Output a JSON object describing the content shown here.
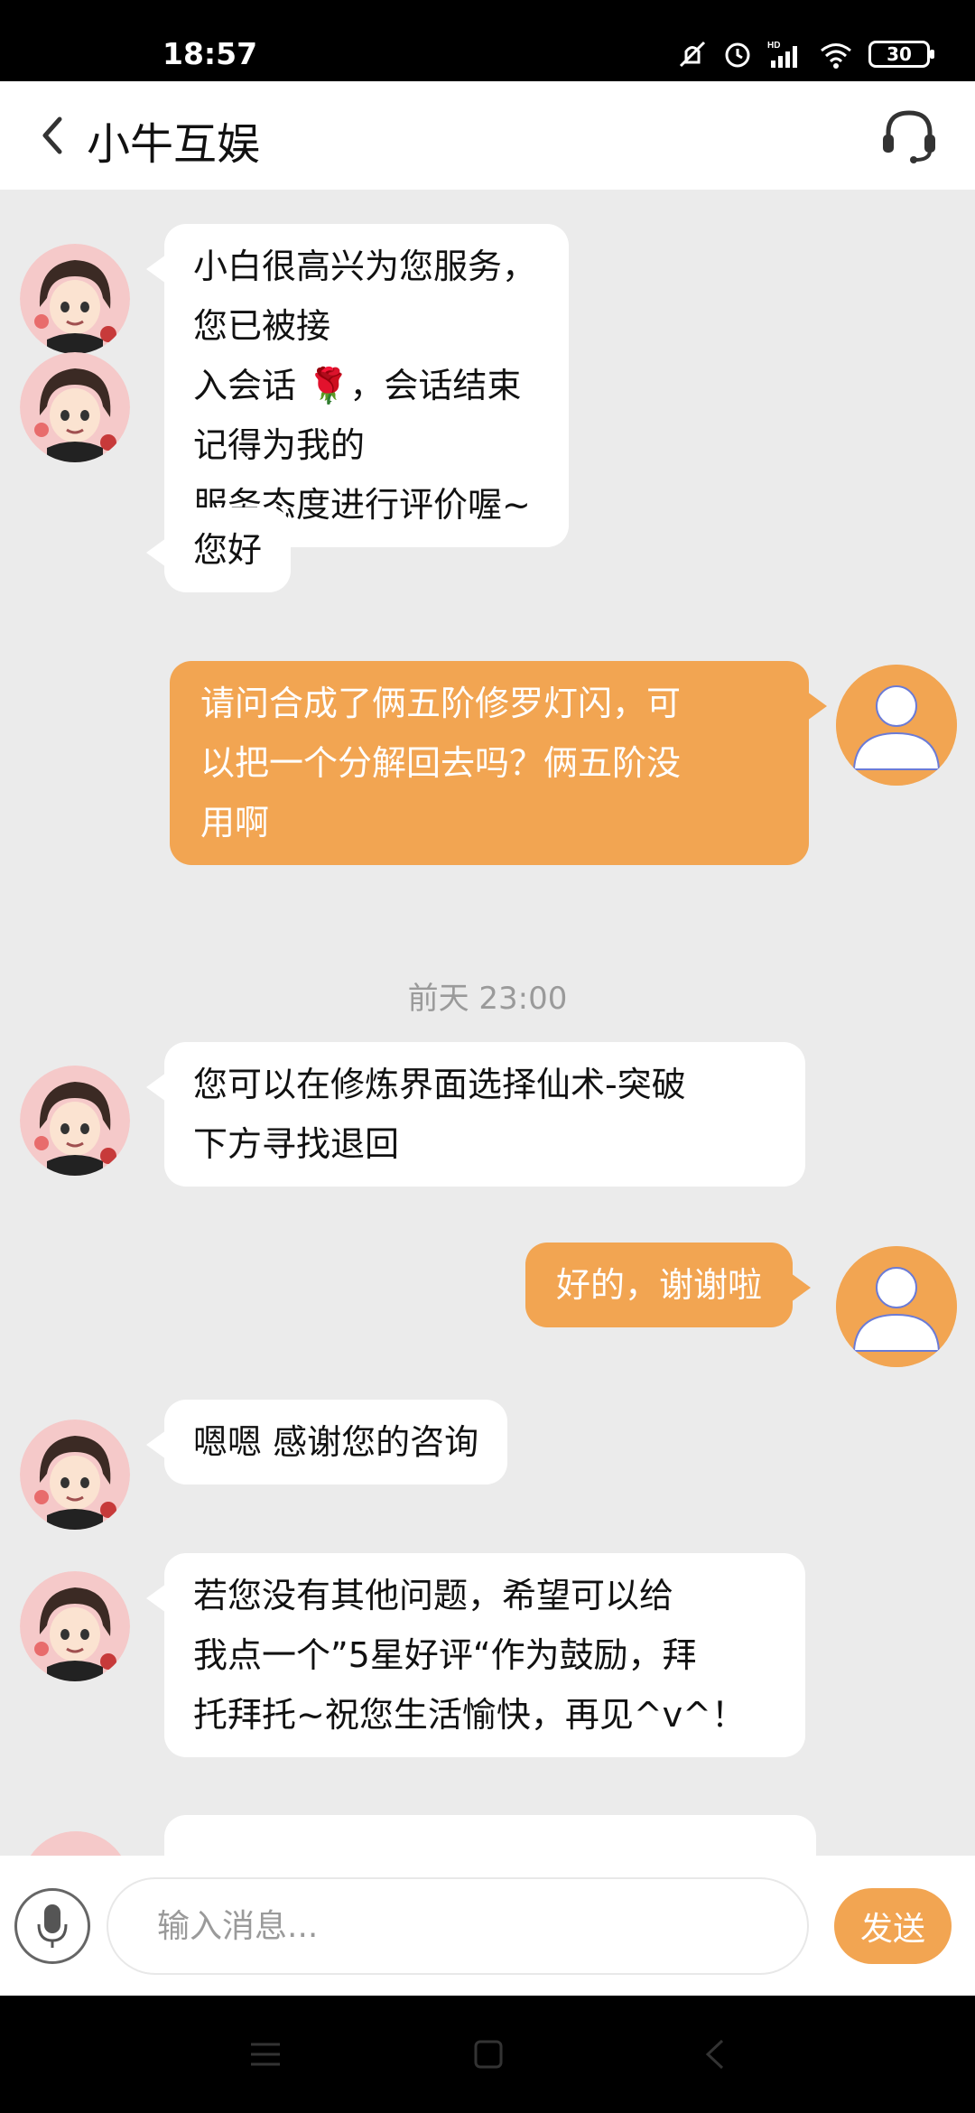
{
  "status_bar": {
    "time": "18:57",
    "battery": "30"
  },
  "header": {
    "title": "小牛互娱"
  },
  "colors": {
    "accent": "#f2a552",
    "background": "#ebebeb"
  },
  "messages": [
    {
      "side": "agent",
      "text_lines": [
        "小白很高兴为您服务，您已被接",
        "入会话 🌹，会话结束记得为我的",
        "服务态度进行评价喔~"
      ]
    },
    {
      "side": "agent",
      "text_lines": [
        "您好"
      ]
    },
    {
      "side": "user",
      "text_lines": [
        "请问合成了俩五阶修罗灯闪，可",
        "以把一个分解回去吗？俩五阶没",
        "用啊"
      ]
    },
    {
      "side": "time",
      "text": "前天 23:00"
    },
    {
      "side": "agent",
      "text_lines": [
        "您可以在修炼界面选择仙术-突破",
        "下方寻找退回"
      ]
    },
    {
      "side": "user",
      "text_lines": [
        "好的，谢谢啦"
      ]
    },
    {
      "side": "agent",
      "text_lines": [
        "嗯嗯 感谢您的咨询"
      ]
    },
    {
      "side": "agent",
      "text_lines": [
        "若您没有其他问题，希望可以给",
        "我点一个”5星好评“作为鼓励，拜",
        "托拜托~祝您生活愉快，再见^v^！"
      ]
    }
  ],
  "input": {
    "placeholder": "输入消息...",
    "value": ""
  },
  "send_label": "发送",
  "icons": {
    "back": "chevron-left-icon",
    "support": "headset-icon",
    "mic": "microphone-icon",
    "agent_avatar": "agent-avatar",
    "user_avatar": "user-avatar"
  }
}
